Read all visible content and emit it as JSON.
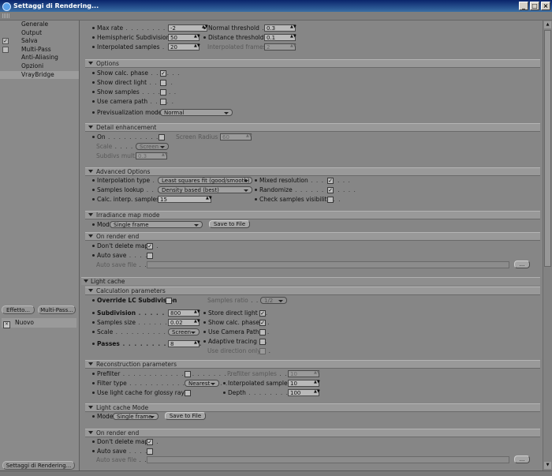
{
  "window": {
    "title": "Settaggi di Rendering..."
  },
  "sidebar": {
    "items": [
      {
        "label": "Generale",
        "check": ""
      },
      {
        "label": "Output",
        "check": ""
      },
      {
        "label": "Salva",
        "check": "✓"
      },
      {
        "label": "Multi-Pass",
        "check": " "
      },
      {
        "label": "Anti-Aliasing",
        "check": ""
      },
      {
        "label": "Opzioni",
        "check": ""
      },
      {
        "label": "VrayBridge",
        "check": ""
      }
    ],
    "effect_button": "Effetto...",
    "multipass_button": "Multi-Pass...",
    "preset_label": "Nuovo",
    "bottom_button": "Settaggi di Rendering..."
  },
  "irradiance": {
    "max_rate_label": "Max rate",
    "max_rate_value": "-2",
    "hemi_label": "Hemispheric Subdivision",
    "hemi_value": "50",
    "interp_label": "Interpolated samples",
    "interp_value": "20",
    "normal_label": "Normal threshold",
    "normal_value": "0.3",
    "distance_label": "Distance threshold",
    "distance_value": "0.1",
    "interp_frames_label": "Interpolated frames",
    "interp_frames_value": "2"
  },
  "options": {
    "header": "Options",
    "show_calc_phase": "Show calc. phase",
    "show_direct_light": "Show direct light",
    "show_samples": "Show samples",
    "use_camera_path": "Use camera path",
    "previs_label": "Previsualization mode",
    "previs_value": "Normal"
  },
  "detail": {
    "header": "Detail enhancement",
    "on_label": "On",
    "scale_label": "Scale",
    "scale_value": "Screen",
    "subdivs_label": "Subdivs mult.",
    "subdivs_value": "0.3",
    "radius_label": "Screen Radius",
    "radius_value": "60"
  },
  "advanced": {
    "header": "Advanced Options",
    "interp_type_label": "Interpolation type",
    "interp_type_value": "Least squares fit (good/smooth)",
    "lookup_label": "Samples lookup",
    "lookup_value": "Density based (best)",
    "calc_label": "Calc. interp. samples",
    "calc_value": "15",
    "mixed_label": "Mixed resolution",
    "randomize_label": "Randomize",
    "check_vis_label": "Check samples visibility"
  },
  "irr_mode": {
    "header": "Irradiance map mode",
    "mode_label": "Mode",
    "mode_value": "Single frame",
    "save_button": "Save to File"
  },
  "irr_end": {
    "header": "On render end",
    "dont_delete": "Don't delete map",
    "auto_save": "Auto save",
    "auto_file": "Auto save file",
    "browse": "..."
  },
  "light_cache": {
    "header": "Light cache",
    "calc_header": "Calculation parameters",
    "override_label": "Override LC Subdivision",
    "ratio_label": "Samples ratio",
    "ratio_value": "1/2",
    "subdivision_label": "Subdivision",
    "subdivision_value": "800",
    "size_label": "Samples size",
    "size_value": "0.02",
    "scale_label": "Scale",
    "scale_value": "Screen",
    "passes_label": "Passes",
    "passes_value": "8",
    "store_label": "Store direct light",
    "show_calc_label": "Show calc. phase",
    "camera_label": "Use Camera Path",
    "adaptive_label": "Adaptive tracing",
    "use_dir_label": "Use direction only",
    "recon_header": "Reconstruction parameters",
    "prefilter_label": "Prefilter",
    "filter_label": "Filter type",
    "filter_value": "Nearest",
    "glossy_label": "Use light cache for glossy rays",
    "pre_samples_label": "Prefilter samples",
    "pre_samples_value": "10",
    "interp_label": "Interpolated samples",
    "interp_value": "10",
    "depth_label": "Depth",
    "depth_value": "100",
    "mode_header": "Light cache Mode",
    "mode_label": "Mode",
    "mode_value": "Single frame",
    "save_button": "Save to File",
    "end_header": "On render end",
    "dont_delete": "Don't delete map",
    "auto_save": "Auto save",
    "auto_file": "Auto save file",
    "browse": "..."
  }
}
